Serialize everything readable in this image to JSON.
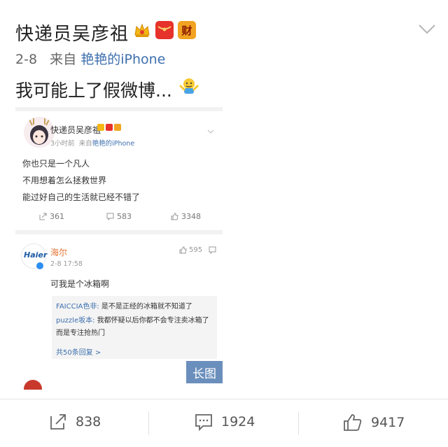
{
  "header": {
    "username": "快递员吴彦祖",
    "badges": [
      "crown-icon",
      "red-packet-icon",
      "财"
    ],
    "date": "2-8",
    "source_prefix": "来自",
    "source": "艳艳的iPhone"
  },
  "post": {
    "text": "我可能上了假微博..."
  },
  "embedded_weibo": {
    "username": "快递员吴彦祖",
    "time": "3小时前",
    "source_prefix": "来自",
    "source": "艳艳的iPhone",
    "lines": [
      "你也只是一个凡人",
      "不用想着怎么拯救世界",
      "能过好自己的生活就已经不错了"
    ],
    "reposts": "361",
    "comments": "583",
    "likes": "3348"
  },
  "comment": {
    "logo": "Haier",
    "username": "海尔",
    "time": "2-8 17:58",
    "likes": "595",
    "text": "可我是个冰箱啊",
    "replies": [
      {
        "user": "FAICCIA色非:",
        "text": " 是不是正经的冰箱就不知道了"
      },
      {
        "user": "puzzle坂本:",
        "text": " 我都怀疑以后你都不会专注卖冰箱了"
      },
      {
        "user": "",
        "text": "而是专注抢热门"
      }
    ],
    "more_replies": "共50条回复 >"
  },
  "long_image_label": "长图",
  "actions": {
    "repost": "838",
    "comment": "1924",
    "like": "9417"
  }
}
